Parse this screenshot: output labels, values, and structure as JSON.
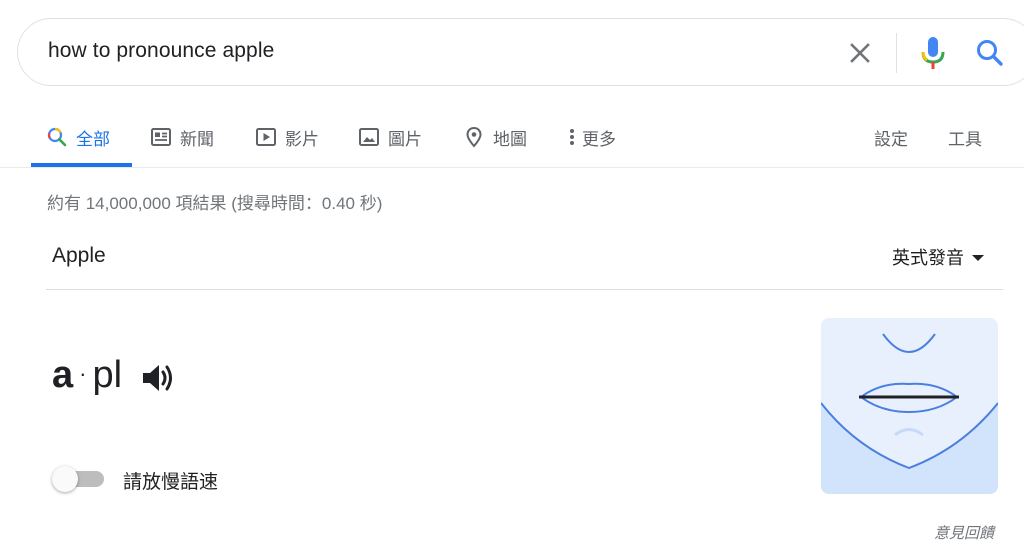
{
  "search": {
    "query": "how to pronounce apple"
  },
  "tabs": [
    {
      "label": "全部",
      "icon": "search-icon",
      "active": true
    },
    {
      "label": "新聞",
      "icon": "news-icon"
    },
    {
      "label": "影片",
      "icon": "video-icon"
    },
    {
      "label": "圖片",
      "icon": "image-icon"
    },
    {
      "label": "地圖",
      "icon": "map-pin-icon"
    },
    {
      "label": "更多",
      "icon": "more-vert-icon"
    }
  ],
  "tools": {
    "settings_label": "設定",
    "tools_label": "工具"
  },
  "result_stats": "約有 14,000,000 項結果 (搜尋時間：0.40 秒)",
  "pronunciation": {
    "word": "Apple",
    "accent": "英式發音",
    "syllable_1": "a",
    "separator": "·",
    "syllable_2": "pl",
    "slow_speed_label": "請放慢語速",
    "slow_speed_on": false
  },
  "feedback_label": "意見回饋",
  "colors": {
    "accent_blue": "#1a73e8",
    "text_secondary": "#70757a",
    "google_blue": "#4285f4",
    "google_red": "#ea4335",
    "google_yellow": "#fbbc05",
    "google_green": "#34a853"
  }
}
